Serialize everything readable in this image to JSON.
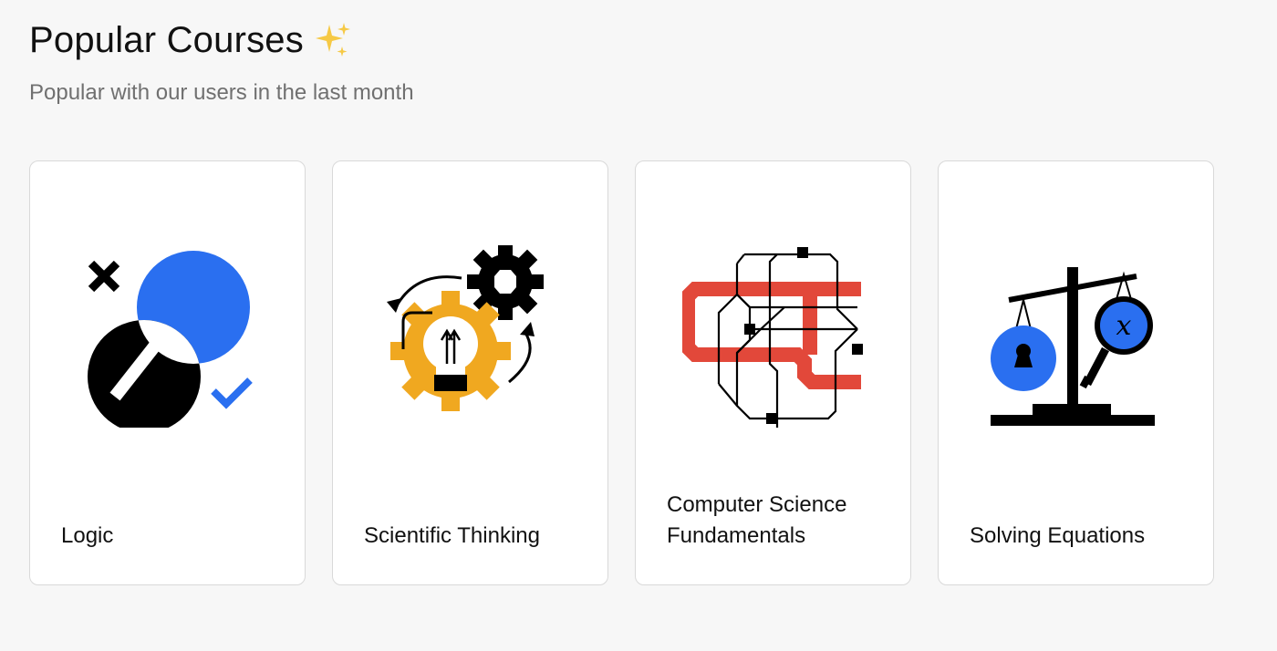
{
  "header": {
    "title": "Popular Courses",
    "title_icon": "sparkles-icon",
    "subtitle": "Popular with our users in the last month"
  },
  "courses": [
    {
      "label": "Logic",
      "icon": "venn-magnifier-icon"
    },
    {
      "label": "Scientific Thinking",
      "icon": "lightbulb-gear-icon"
    },
    {
      "label": "Computer Science Fundamentals",
      "icon": "circuit-icon"
    },
    {
      "label": "Solving Equations",
      "icon": "balance-scale-icon"
    }
  ],
  "colors": {
    "background": "#f7f7f7",
    "card": "#ffffff",
    "blue": "#2a6ff0",
    "orange": "#f0a820",
    "red": "#e2483a",
    "black": "#000000"
  }
}
